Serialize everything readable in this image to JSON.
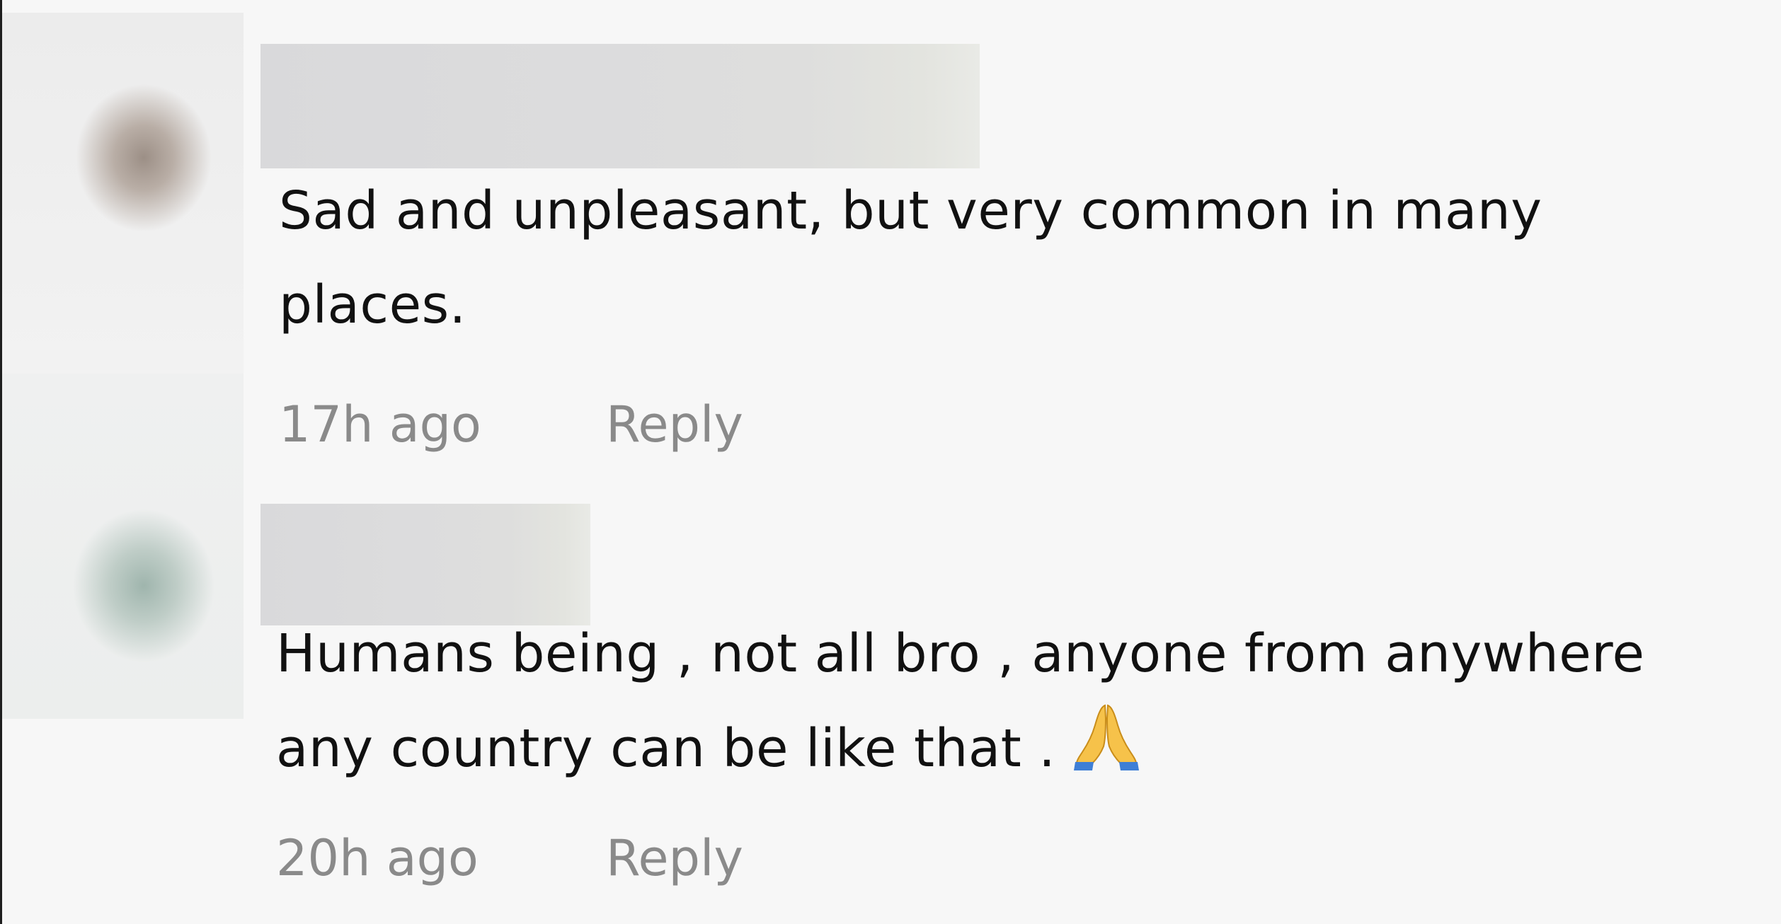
{
  "comments": [
    {
      "text_line1": "Sad and unpleasant, but very common in many",
      "text_line2": "places.",
      "timestamp": "17h ago",
      "reply_label": "Reply"
    },
    {
      "text_line1": "Humans being , not all bro , anyone from anywhere",
      "text_line2": "any country can be like that .",
      "emoji": "folded-hands-icon",
      "timestamp": "20h ago",
      "reply_label": "Reply"
    }
  ],
  "colors": {
    "background": "#f7f7f7",
    "text": "#111111",
    "meta": "#8a8a8a"
  }
}
